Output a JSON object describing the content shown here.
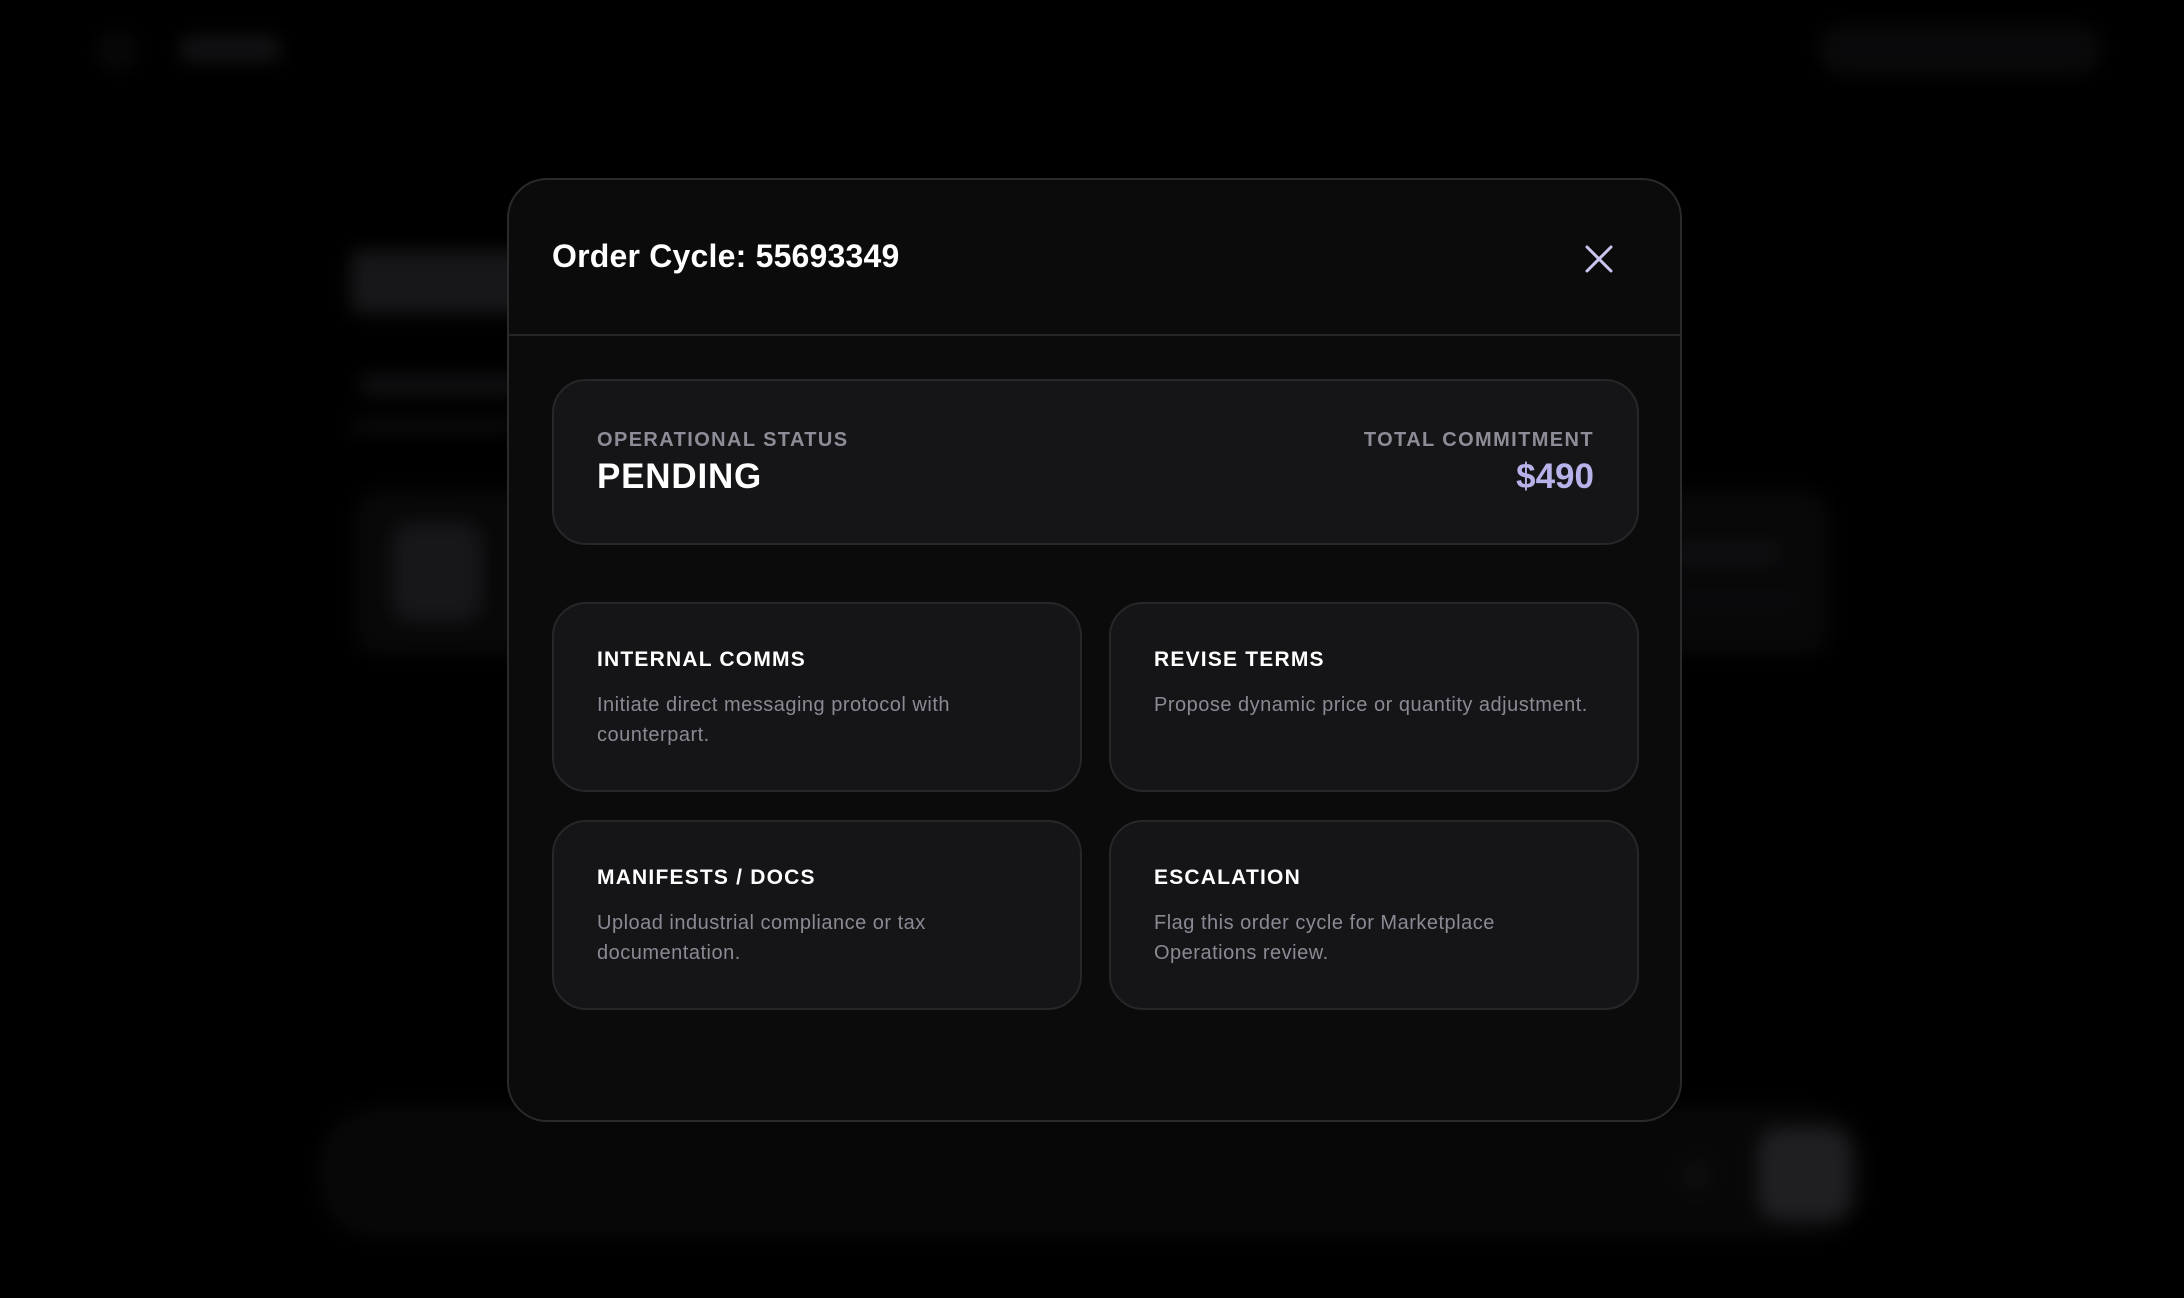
{
  "modal": {
    "title": "Order Cycle: 55693349",
    "status": {
      "label": "OPERATIONAL STATUS",
      "value": "PENDING"
    },
    "commitment": {
      "label": "TOTAL COMMITMENT",
      "value": "$490",
      "color": "#b7b3ea"
    },
    "actions": [
      {
        "title": "INTERNAL COMMS",
        "description": "Initiate direct messaging protocol with counterpart."
      },
      {
        "title": "REVISE TERMS",
        "description": "Propose dynamic price or quantity adjustment."
      },
      {
        "title": "MANIFESTS / DOCS",
        "description": "Upload industrial compliance or tax documentation."
      },
      {
        "title": "ESCALATION",
        "description": "Flag this order cycle for Marketplace Operations review."
      }
    ],
    "close_icon": "close-icon"
  },
  "background": {
    "icons": [
      "search-icon",
      "send-icon"
    ],
    "theme_background": "#000000",
    "modal_background": "#0b0b0c"
  }
}
